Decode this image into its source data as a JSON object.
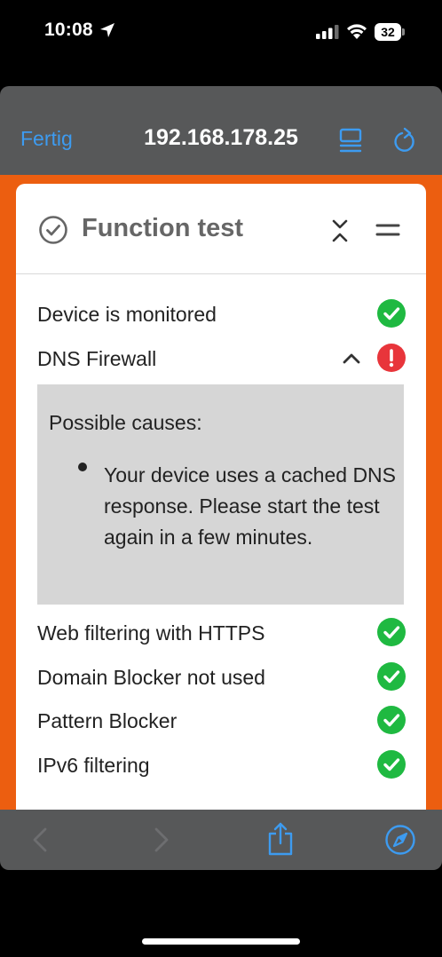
{
  "status_bar": {
    "time": "10:08",
    "battery": "32"
  },
  "browser": {
    "done_label": "Fertig",
    "address": "192.168.178.25"
  },
  "card": {
    "title": "Function test",
    "tests": [
      {
        "label": "Device is monitored",
        "status": "ok"
      },
      {
        "label": "DNS Firewall",
        "status": "error",
        "expanded": true
      },
      {
        "label": "Web filtering with HTTPS",
        "status": "ok"
      },
      {
        "label": "Domain Blocker not used",
        "status": "ok"
      },
      {
        "label": "Pattern Blocker",
        "status": "ok"
      },
      {
        "label": "IPv6 filtering",
        "status": "ok"
      }
    ],
    "details": {
      "heading": "Possible causes:",
      "causes": [
        "Your device uses a cached DNS response. Please start the test again in a few minutes."
      ]
    }
  },
  "colors": {
    "accent": "#3d9bf0",
    "page_background": "#ec5e10",
    "ok": "#1fb941",
    "error": "#e8353b",
    "chrome": "#575859"
  },
  "icons": {
    "location": "location-arrow-icon",
    "signal": "cellular-signal-icon",
    "wifi": "wifi-icon",
    "reader": "reader-view-icon",
    "reload": "reload-icon",
    "title": "check-circle-icon",
    "collapse": "collapse-icon",
    "menu": "menu-icon",
    "ok": "check-icon",
    "error": "exclamation-icon",
    "toolbar": [
      "back-icon",
      "forward-icon",
      "share-icon",
      "compass-icon"
    ]
  }
}
